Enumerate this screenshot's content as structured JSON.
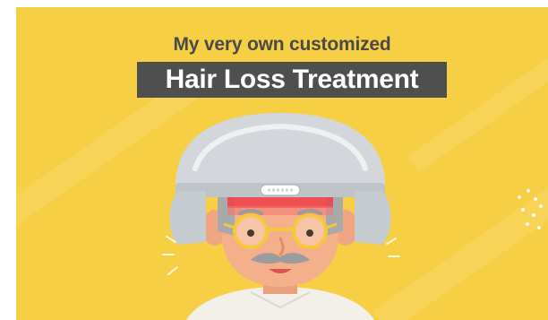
{
  "banner": {
    "subtitle": "My very own customized",
    "title": "Hair Loss Treatment"
  },
  "colors": {
    "background": "#f6cf45",
    "title_box": "#4f4f4f",
    "subtitle_text": "#4a4a4a",
    "title_text": "#ffffff",
    "helmet": "#d3d7db",
    "skin": "#f4b08a",
    "glasses": "#f5c93a",
    "red_light": "#ef3e4a"
  },
  "illustration": {
    "figure": "elderly-man-with-glasses-and-mustache",
    "device": "laser-hair-growth-helmet",
    "icons": [
      "helmet-icon",
      "glasses-icon",
      "mustache-icon",
      "sparkle-icon"
    ]
  }
}
